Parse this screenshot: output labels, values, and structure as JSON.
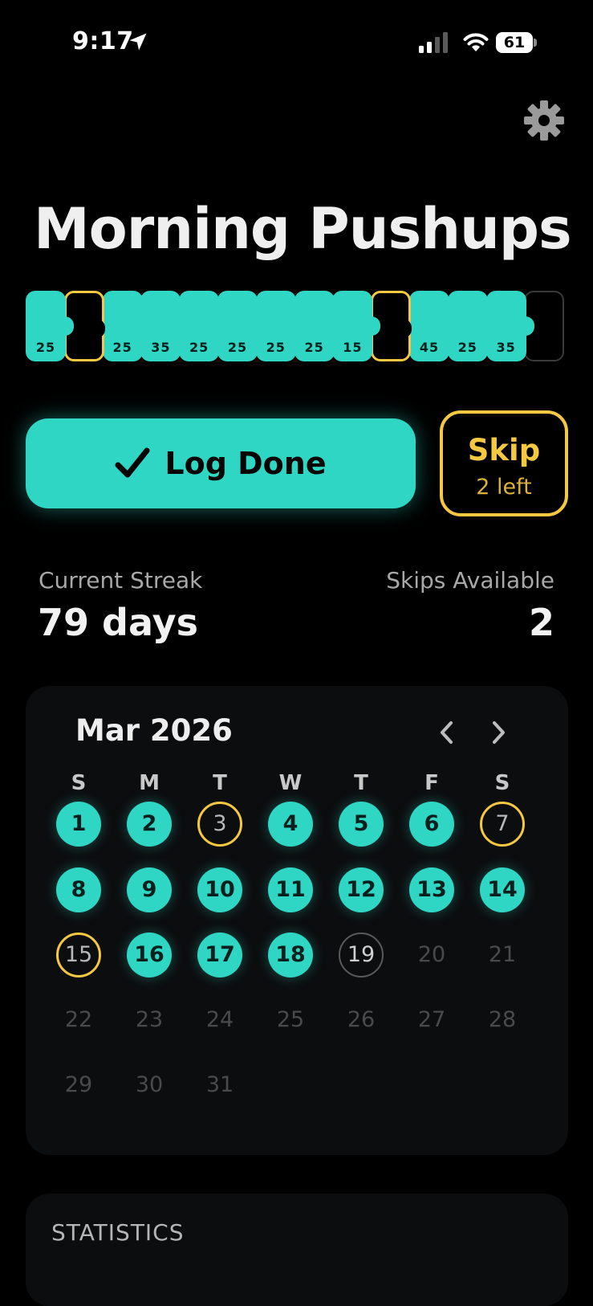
{
  "status_bar": {
    "time": "9:17",
    "battery": "61"
  },
  "habit": {
    "title": "Morning Pushups"
  },
  "chain": [
    {
      "state": "done",
      "value": "25"
    },
    {
      "state": "skip",
      "value": ""
    },
    {
      "state": "done",
      "value": "25"
    },
    {
      "state": "done",
      "value": "35"
    },
    {
      "state": "done",
      "value": "25"
    },
    {
      "state": "done",
      "value": "25"
    },
    {
      "state": "done",
      "value": "25"
    },
    {
      "state": "done",
      "value": "25"
    },
    {
      "state": "done",
      "value": "15"
    },
    {
      "state": "skip",
      "value": ""
    },
    {
      "state": "done",
      "value": "45"
    },
    {
      "state": "done",
      "value": "25"
    },
    {
      "state": "done",
      "value": "35"
    },
    {
      "state": "empty",
      "value": ""
    }
  ],
  "actions": {
    "log_label": "Log Done",
    "skip_label": "Skip",
    "skip_sub": "2 left"
  },
  "stats": {
    "streak_label": "Current Streak",
    "streak_value": "79 days",
    "skips_label": "Skips Available",
    "skips_value": "2"
  },
  "calendar": {
    "month": "Mar 2026",
    "weekdays": [
      "S",
      "M",
      "T",
      "W",
      "T",
      "F",
      "S"
    ],
    "days": [
      {
        "n": "1",
        "state": "done"
      },
      {
        "n": "2",
        "state": "done"
      },
      {
        "n": "3",
        "state": "skip"
      },
      {
        "n": "4",
        "state": "done"
      },
      {
        "n": "5",
        "state": "done"
      },
      {
        "n": "6",
        "state": "done"
      },
      {
        "n": "7",
        "state": "skip"
      },
      {
        "n": "8",
        "state": "done"
      },
      {
        "n": "9",
        "state": "done"
      },
      {
        "n": "10",
        "state": "done"
      },
      {
        "n": "11",
        "state": "done"
      },
      {
        "n": "12",
        "state": "done"
      },
      {
        "n": "13",
        "state": "done"
      },
      {
        "n": "14",
        "state": "done"
      },
      {
        "n": "15",
        "state": "skip"
      },
      {
        "n": "16",
        "state": "done"
      },
      {
        "n": "17",
        "state": "done"
      },
      {
        "n": "18",
        "state": "done"
      },
      {
        "n": "19",
        "state": "today"
      },
      {
        "n": "20",
        "state": "future"
      },
      {
        "n": "21",
        "state": "future"
      },
      {
        "n": "22",
        "state": "future"
      },
      {
        "n": "23",
        "state": "future"
      },
      {
        "n": "24",
        "state": "future"
      },
      {
        "n": "25",
        "state": "future"
      },
      {
        "n": "26",
        "state": "future"
      },
      {
        "n": "27",
        "state": "future"
      },
      {
        "n": "28",
        "state": "future"
      },
      {
        "n": "29",
        "state": "future"
      },
      {
        "n": "30",
        "state": "future"
      },
      {
        "n": "31",
        "state": "future"
      }
    ]
  },
  "statistics": {
    "heading": "STATISTICS"
  },
  "colors": {
    "accent": "#2fd6c3",
    "skip": "#f5c842",
    "background": "#000000",
    "card": "#0c0d0f"
  },
  "icons": [
    "location-arrow-icon",
    "signal-icon",
    "wifi-icon",
    "battery-icon",
    "gear-icon",
    "checkmark-icon",
    "chevron-left-icon",
    "chevron-right-icon"
  ]
}
